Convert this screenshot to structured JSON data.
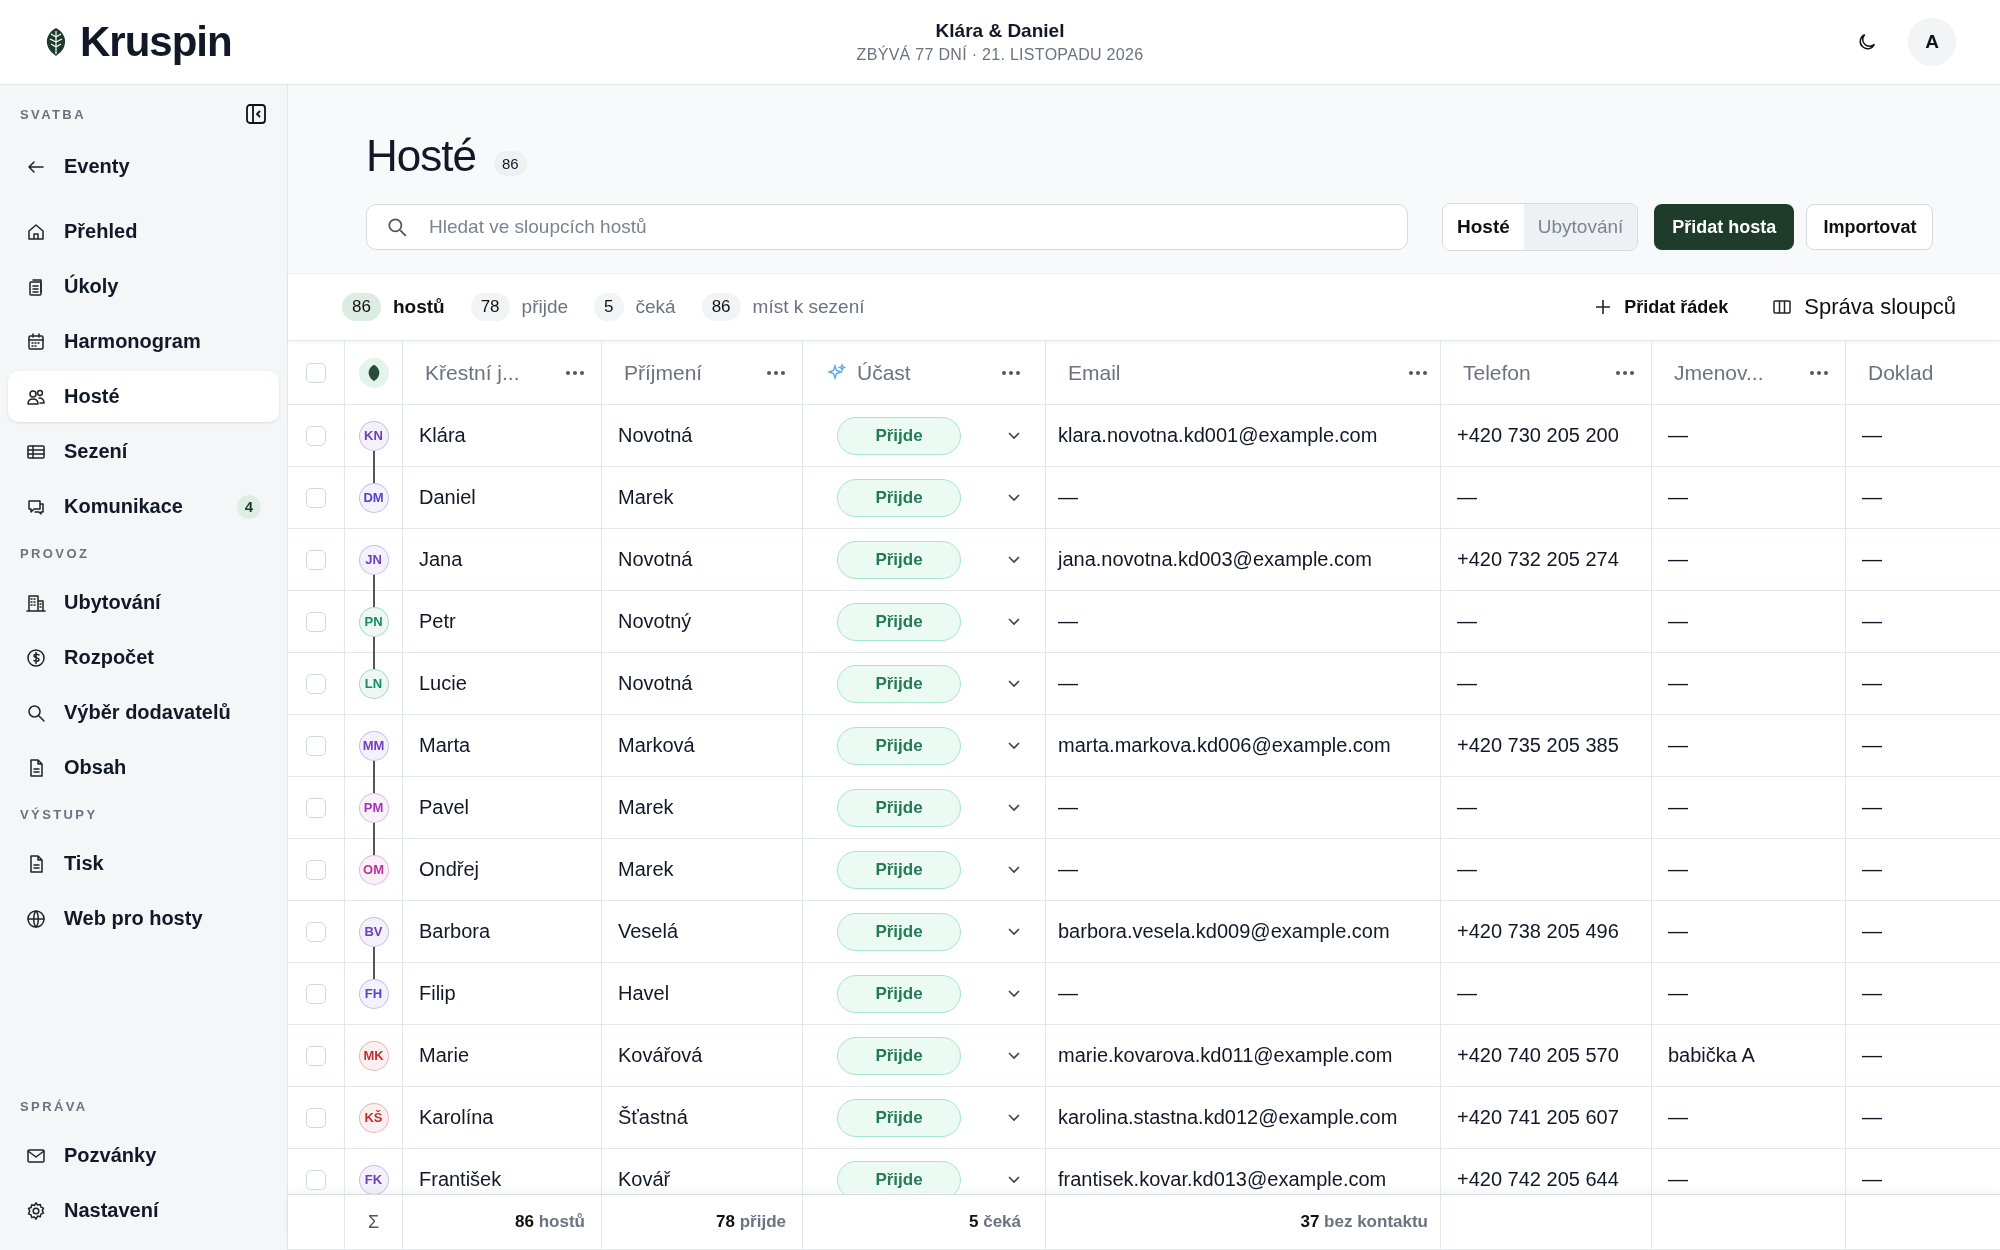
{
  "brand": {
    "name": "Kruspin"
  },
  "event": {
    "title": "Klára & Daniel",
    "subtitle": "ZBÝVÁ 77 DNÍ · 21. LISTOPADU 2026"
  },
  "user": {
    "initial": "A"
  },
  "sidebar": {
    "sections": [
      {
        "title": "SVATBA",
        "items": [
          {
            "label": "Eventy",
            "selected": false
          }
        ]
      },
      {
        "items": [
          {
            "label": "Přehled",
            "selected": false
          },
          {
            "label": "Úkoly",
            "selected": false
          },
          {
            "label": "Harmonogram",
            "selected": false
          },
          {
            "label": "Hosté",
            "selected": true
          },
          {
            "label": "Sezení",
            "selected": false
          },
          {
            "label": "Komunikace",
            "selected": false,
            "badge": "4"
          }
        ]
      },
      {
        "title": "PROVOZ",
        "items": [
          {
            "label": "Ubytování",
            "selected": false
          },
          {
            "label": "Rozpočet",
            "selected": false
          },
          {
            "label": "Výběr dodavatelů",
            "selected": false
          },
          {
            "label": "Obsah",
            "selected": false
          }
        ]
      },
      {
        "title": "VÝSTUPY",
        "items": [
          {
            "label": "Tisk",
            "selected": false
          },
          {
            "label": "Web pro hosty",
            "selected": false
          }
        ]
      },
      {
        "title": "SPRÁVA",
        "items": [
          {
            "label": "Pozvánky",
            "selected": false
          },
          {
            "label": "Nastavení",
            "selected": false
          }
        ]
      }
    ]
  },
  "page": {
    "title": "Hosté",
    "count": "86",
    "search_placeholder": "Hledat ve sloupcích hostů",
    "view_tabs": [
      {
        "label": "Hosté",
        "selected": true
      },
      {
        "label": "Ubytování",
        "selected": false
      }
    ],
    "primary_button": "Přidat hosta",
    "secondary_button": "Importovat"
  },
  "stats": [
    {
      "count": "86",
      "label": "hostů",
      "selected": true
    },
    {
      "count": "78",
      "label": "přijde",
      "selected": false
    },
    {
      "count": "5",
      "label": "čeká",
      "selected": false
    },
    {
      "count": "86",
      "label": "míst k sezení",
      "selected": false
    }
  ],
  "table_actions": [
    "Přidat řádek",
    "Správa sloupců"
  ],
  "table": {
    "select_all_checked": false,
    "columns": [
      {
        "label": "Křestní j...",
        "kind": "text"
      },
      {
        "label": "Příjmení",
        "kind": "text"
      },
      {
        "label": "Účast",
        "kind": "status"
      },
      {
        "label": "Email",
        "kind": "text"
      },
      {
        "label": "Telefon",
        "kind": "text"
      },
      {
        "label": "Jmenov...",
        "kind": "text"
      },
      {
        "label": "Doklad",
        "kind": "plain"
      }
    ],
    "rows": [
      {
        "initials": "KN",
        "color": "#6d3fc0",
        "linked_to_next": true,
        "checked": false,
        "cells": [
          "Klára",
          "Novotná",
          "Přijde",
          "klara.novotna.kd001@example.com",
          "+420 730 205 200",
          "—",
          "—"
        ]
      },
      {
        "initials": "DM",
        "color": "#4f46c8",
        "linked_to_next": false,
        "checked": false,
        "cells": [
          "Daniel",
          "Marek",
          "Přijde",
          "—",
          "—",
          "—",
          "—"
        ]
      },
      {
        "initials": "JN",
        "color": "#6d3fc0",
        "linked_to_next": true,
        "checked": false,
        "cells": [
          "Jana",
          "Novotná",
          "Přijde",
          "jana.novotna.kd003@example.com",
          "+420 732 205 274",
          "—",
          "—"
        ]
      },
      {
        "initials": "PN",
        "color": "#138a6a",
        "linked_to_next": true,
        "checked": false,
        "cells": [
          "Petr",
          "Novotný",
          "Přijde",
          "—",
          "—",
          "—",
          "—"
        ]
      },
      {
        "initials": "LN",
        "color": "#138a6a",
        "linked_to_next": false,
        "checked": false,
        "cells": [
          "Lucie",
          "Novotná",
          "Přijde",
          "—",
          "—",
          "—",
          "—"
        ]
      },
      {
        "initials": "MM",
        "color": "#6d3fc0",
        "linked_to_next": true,
        "checked": false,
        "cells": [
          "Marta",
          "Marková",
          "Přijde",
          "marta.markova.kd006@example.com",
          "+420 735 205 385",
          "—",
          "—"
        ]
      },
      {
        "initials": "PM",
        "color": "#a632b8",
        "linked_to_next": true,
        "checked": false,
        "cells": [
          "Pavel",
          "Marek",
          "Přijde",
          "—",
          "—",
          "—",
          "—"
        ]
      },
      {
        "initials": "OM",
        "color": "#b8329a",
        "linked_to_next": false,
        "checked": false,
        "cells": [
          "Ondřej",
          "Marek",
          "Přijde",
          "—",
          "—",
          "—",
          "—"
        ]
      },
      {
        "initials": "BV",
        "color": "#6d3fc0",
        "linked_to_next": true,
        "checked": false,
        "cells": [
          "Barbora",
          "Veselá",
          "Přijde",
          "barbora.vesela.kd009@example.com",
          "+420 738 205 496",
          "—",
          "—"
        ]
      },
      {
        "initials": "FH",
        "color": "#4f46c8",
        "linked_to_next": false,
        "checked": false,
        "cells": [
          "Filip",
          "Havel",
          "Přijde",
          "—",
          "—",
          "—",
          "—"
        ]
      },
      {
        "initials": "MK",
        "color": "#c03030",
        "linked_to_next": false,
        "checked": false,
        "cells": [
          "Marie",
          "Kovářová",
          "Přijde",
          "marie.kovarova.kd011@example.com",
          "+420 740 205 570",
          "babička A",
          "—"
        ]
      },
      {
        "initials": "KŠ",
        "color": "#c03030",
        "linked_to_next": false,
        "checked": false,
        "cells": [
          "Karolína",
          "Šťastná",
          "Přijde",
          "karolina.stastna.kd012@example.com",
          "+420 741 205 607",
          "—",
          "—"
        ]
      },
      {
        "initials": "FK",
        "color": "#6d3fc0",
        "linked_to_next": false,
        "checked": false,
        "cells": [
          "František",
          "Kovář",
          "Přijde",
          "frantisek.kovar.kd013@example.com",
          "+420 742 205 644",
          "—",
          "—"
        ]
      }
    ],
    "footer": {
      "sum_symbol": "Σ",
      "cells": [
        "**86** hostů",
        "**78** přijde",
        "**5** čeká",
        "**37** bez kontaktu"
      ]
    }
  }
}
